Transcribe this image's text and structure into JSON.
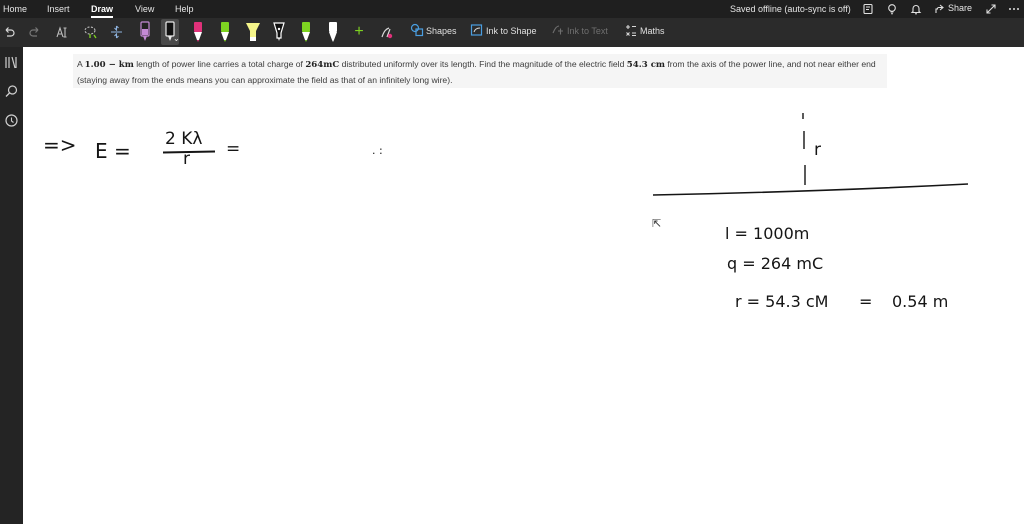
{
  "menu": {
    "tabs": [
      "Home",
      "Insert",
      "Draw",
      "View",
      "Help"
    ],
    "active_tab": "Draw",
    "sync_status": "Saved offline (auto-sync is off)",
    "share_label": "Share"
  },
  "ribbon": {
    "shapes_label": "Shapes",
    "ink_to_shape_label": "Ink to Shape",
    "ink_to_text_label": "Ink to Text",
    "maths_label": "Maths",
    "pens": [
      {
        "color": "#c48ad6",
        "icon": "pen-icon"
      },
      {
        "color": "#111111",
        "icon": "pen-icon",
        "selected": true
      },
      {
        "color": "#e0317a",
        "icon": "pen-icon"
      },
      {
        "color": "#7ed321",
        "icon": "pen-icon"
      },
      {
        "color": "#f5f58a",
        "icon": "highlighter-icon"
      },
      {
        "color": "#ffffff",
        "icon": "pen-icon"
      },
      {
        "color": "#7ed321",
        "icon": "pen-icon"
      },
      {
        "color": "#ffffff",
        "icon": "pen-icon"
      }
    ]
  },
  "question": {
    "p1": "A ",
    "length": "1.00 − km",
    "p2": " length of power line carries a total charge of ",
    "charge": "264mC",
    "p3": " distributed uniformly over its length. Find the magnitude of the electric field ",
    "distance": "54.3 cm",
    "p4": " from the axis of the power line, and not near either end (staying away from the ends means you can approximate the field as that of an infinitely long wire)."
  },
  "ink": {
    "arrow": "=>",
    "lhs": "E =",
    "numerator": "2 Kλ",
    "denominator": "r",
    "equals": "=",
    "dots": ". :",
    "r_label": "r",
    "given_l": "l = 1000m",
    "given_q": "q = 264 mC",
    "given_r1": "r = 54.3 cM",
    "given_eq": "=",
    "given_r2": "0.54 m"
  }
}
